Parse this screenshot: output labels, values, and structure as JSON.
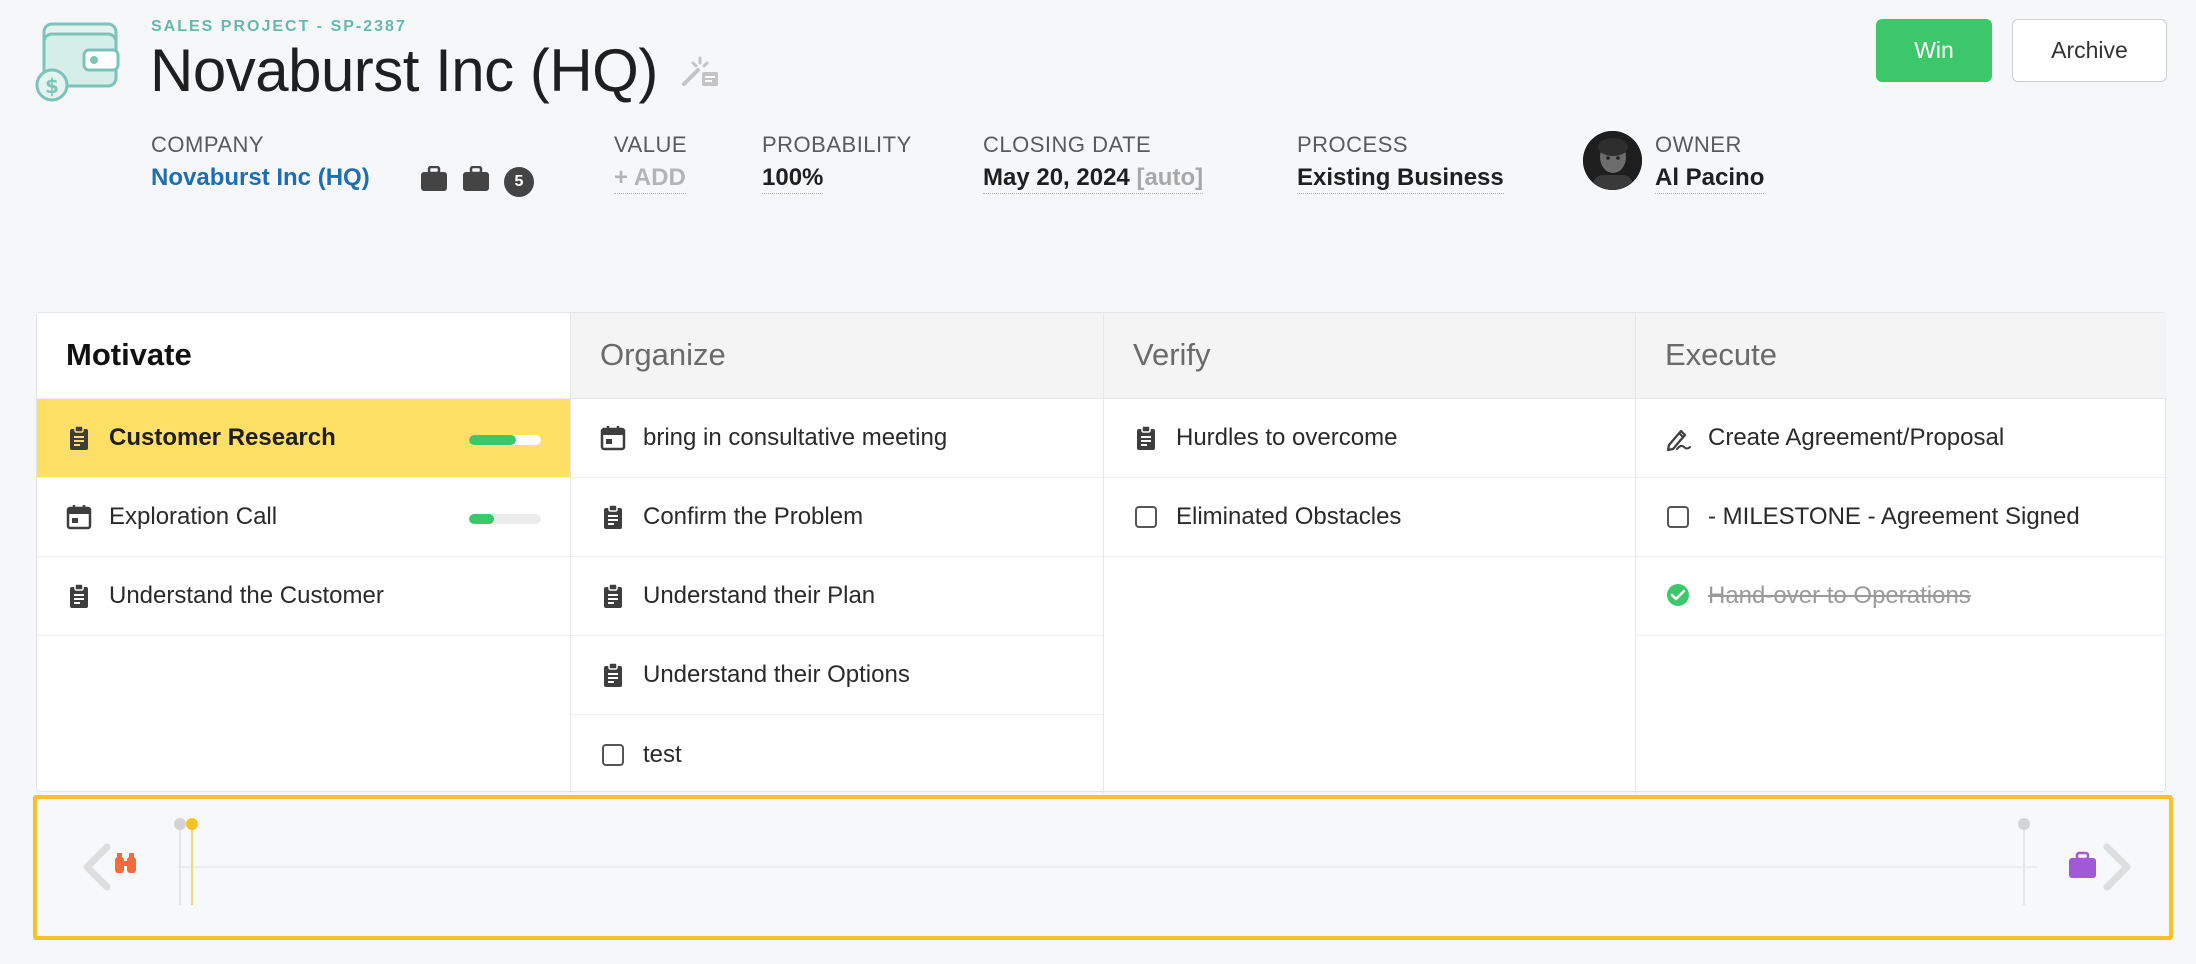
{
  "header": {
    "project_label": "SALES PROJECT - SP-2387",
    "title": "Novaburst Inc (HQ)",
    "win_label": "Win",
    "archive_label": "Archive"
  },
  "fields": {
    "company": {
      "label": "COMPANY",
      "value": "Novaburst Inc (HQ)",
      "badge_count": "5"
    },
    "value": {
      "label": "VALUE",
      "value": "+ ADD"
    },
    "probability": {
      "label": "PROBABILITY",
      "value": "100%"
    },
    "closing_date": {
      "label": "CLOSING DATE",
      "value": "May 20, 2024",
      "suffix": "[auto]"
    },
    "process": {
      "label": "PROCESS",
      "value": "Existing Business"
    },
    "owner": {
      "label": "OWNER",
      "value": "Al Pacino"
    }
  },
  "columns": [
    {
      "title": "Motivate",
      "items": [
        {
          "label": "Customer Research",
          "icon": "clipboard-icon",
          "progress": 0.65
        },
        {
          "label": "Exploration Call",
          "icon": "calendar-icon",
          "progress": 0.35
        },
        {
          "label": "Understand the Customer",
          "icon": "clipboard-icon"
        }
      ]
    },
    {
      "title": "Organize",
      "items": [
        {
          "label": "bring in consultative meeting",
          "icon": "calendar-icon"
        },
        {
          "label": "Confirm the Problem",
          "icon": "clipboard-icon"
        },
        {
          "label": "Understand their Plan",
          "icon": "clipboard-icon"
        },
        {
          "label": "Understand their Options",
          "icon": "clipboard-icon"
        },
        {
          "label": "test",
          "icon": "checkbox-icon"
        }
      ]
    },
    {
      "title": "Verify",
      "items": [
        {
          "label": "Hurdles to overcome",
          "icon": "clipboard-icon"
        },
        {
          "label": "Eliminated Obstacles",
          "icon": "checkbox-icon"
        }
      ]
    },
    {
      "title": "Execute",
      "items": [
        {
          "label": "Create Agreement/Proposal",
          "icon": "signature-icon"
        },
        {
          "label": "- MILESTONE - Agreement Signed",
          "icon": "checkbox-icon"
        },
        {
          "label": "Hand-over to Operations",
          "icon": "check-circle-icon"
        }
      ]
    }
  ],
  "colors": {
    "accent_green": "#3cc76a",
    "highlight_yellow": "#ffe066",
    "timeline_border": "#f7c324",
    "link_blue": "#1f6fb0",
    "label_teal": "#66b8ad",
    "start_icon_orange": "#f26b3a",
    "end_icon_purple": "#a05ad8"
  }
}
